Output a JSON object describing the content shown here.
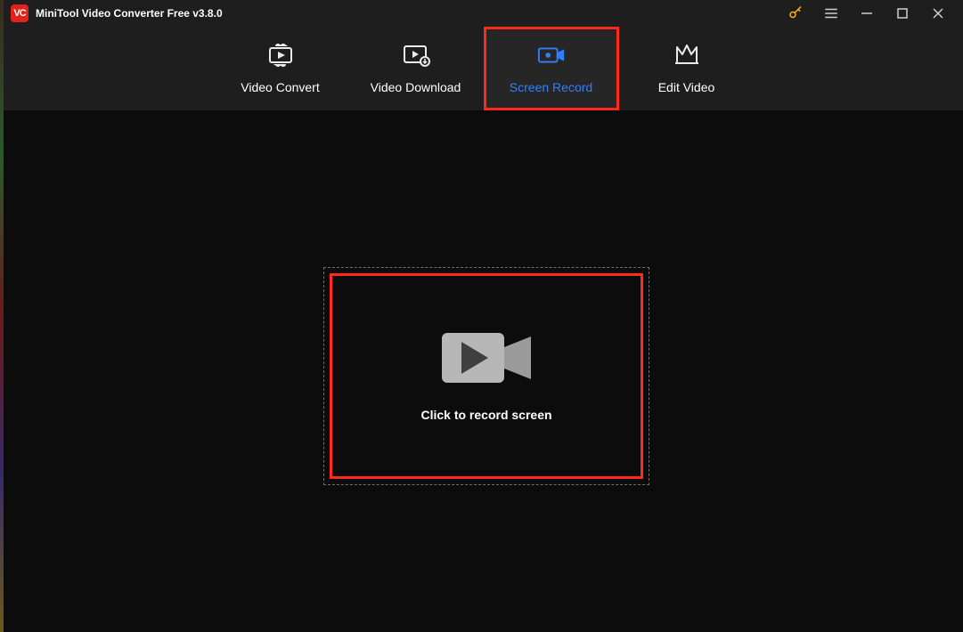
{
  "title": "MiniTool Video Converter Free v3.8.0",
  "tabs": {
    "convert": "Video Convert",
    "download": "Video Download",
    "record": "Screen Record",
    "edit": "Edit Video"
  },
  "main": {
    "record_prompt": "Click to record screen"
  }
}
